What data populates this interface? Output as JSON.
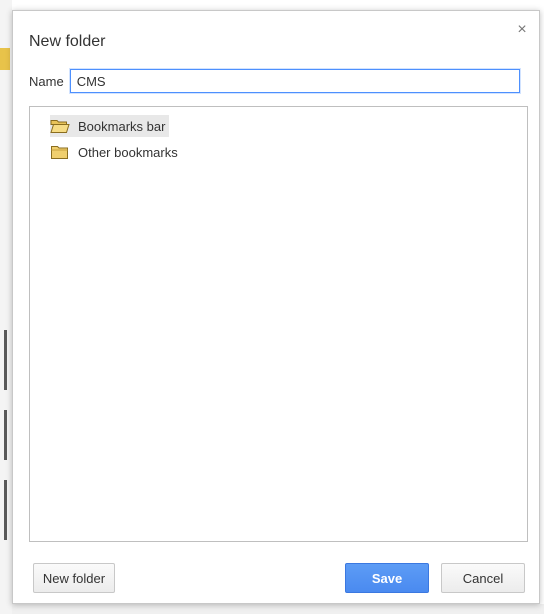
{
  "dialog": {
    "title": "New folder",
    "close_glyph": "×",
    "name_label": "Name",
    "name_value": "CMS",
    "tree": [
      {
        "label": "Bookmarks bar",
        "icon": "open-folder-icon",
        "selected": true
      },
      {
        "label": "Other bookmarks",
        "icon": "folder-icon",
        "selected": false
      }
    ],
    "buttons": {
      "new_folder": "New folder",
      "save": "Save",
      "cancel": "Cancel"
    }
  },
  "colors": {
    "accent": "#4a8af0",
    "folder": "#e8c35a",
    "selection": "#e8e8e8"
  }
}
